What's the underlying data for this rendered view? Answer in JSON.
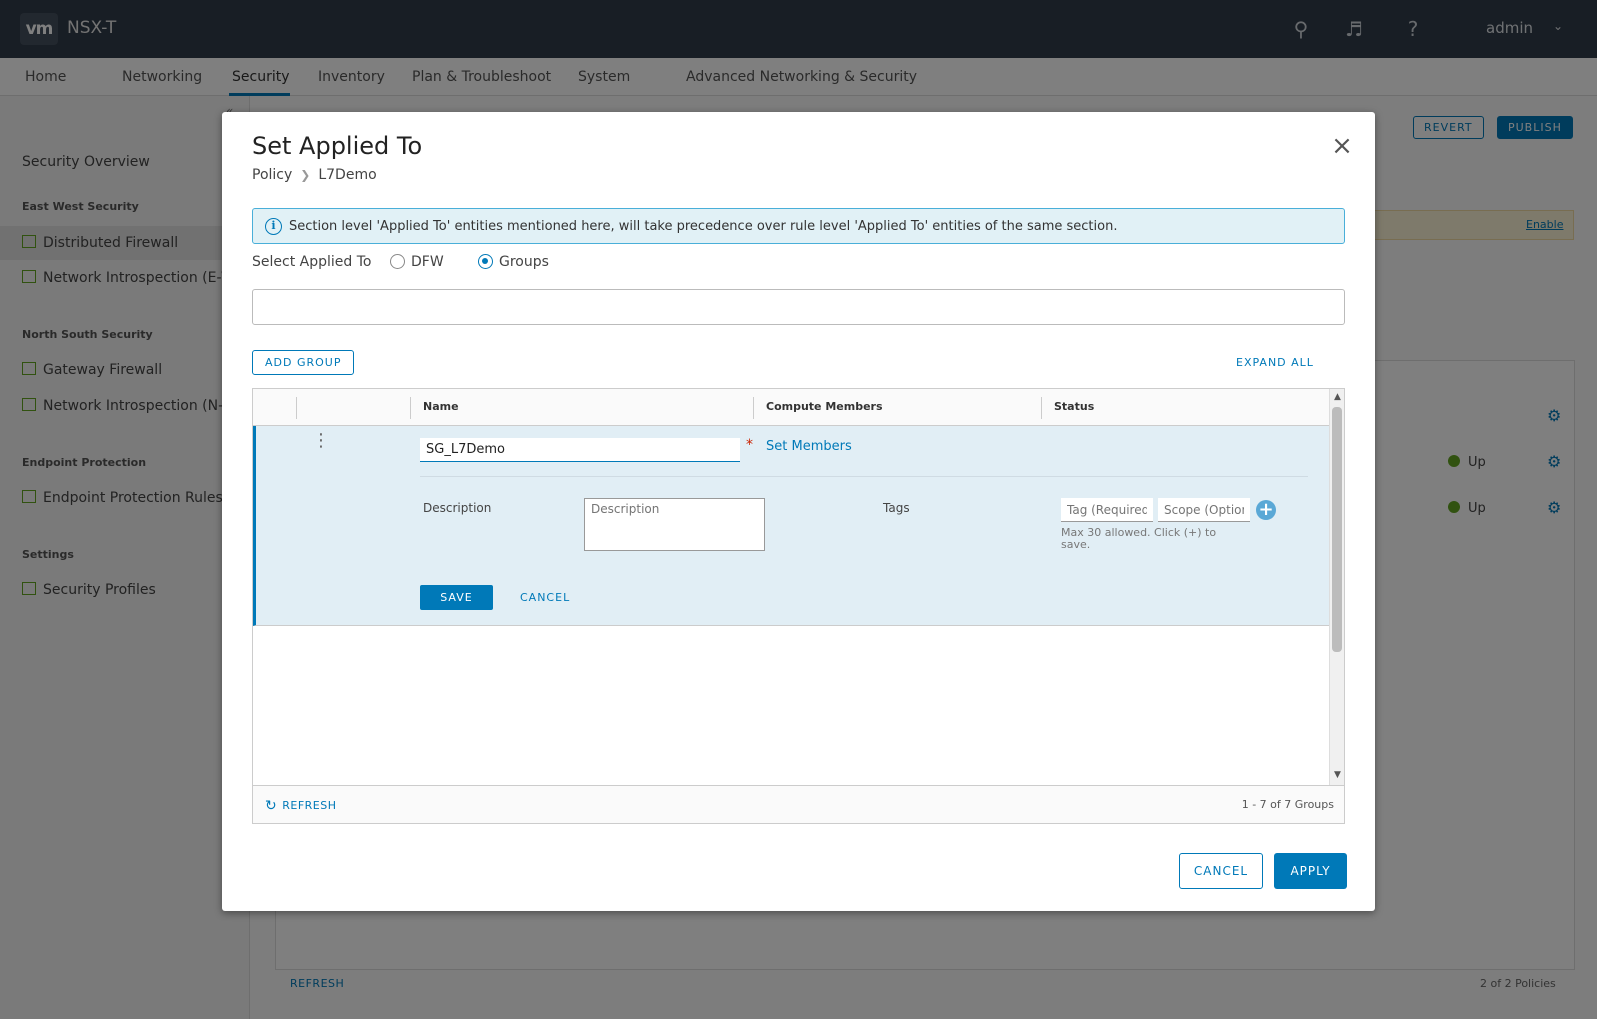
{
  "app": {
    "logo_text": "vm",
    "product_name": "NSX-T",
    "user": "admin"
  },
  "nav": {
    "items": [
      "Home",
      "Networking",
      "Security",
      "Inventory",
      "Plan & Troubleshoot",
      "System",
      "Advanced Networking & Security"
    ],
    "active": "Security"
  },
  "sidebar": {
    "overview": "Security Overview",
    "sections": [
      {
        "title": "East West Security",
        "items": [
          "Distributed Firewall",
          "Network Introspection (E-W)"
        ]
      },
      {
        "title": "North South Security",
        "items": [
          "Gateway Firewall",
          "Network Introspection (N-S)"
        ]
      },
      {
        "title": "Endpoint Protection",
        "items": [
          "Endpoint Protection Rules"
        ]
      },
      {
        "title": "Settings",
        "items": [
          "Security Profiles"
        ]
      }
    ],
    "selected": "Distributed Firewall"
  },
  "background": {
    "revert_label": "REVERT",
    "publish_label": "PUBLISH",
    "enable_label": "Enable",
    "rows": [
      {
        "status": "Up"
      },
      {
        "status": "Up"
      }
    ],
    "refresh_label": "REFRESH",
    "pager": "2 of 2 Policies"
  },
  "modal": {
    "title": "Set Applied To",
    "breadcrumb": [
      "Policy",
      "L7Demo"
    ],
    "info_text": "Section level 'Applied To' entities mentioned here, will take precedence over rule level 'Applied To' entities of the same section.",
    "select_label": "Select Applied To",
    "radio_dfw": "DFW",
    "radio_groups": "Groups",
    "selected_radio": "Groups",
    "search_value": "",
    "add_group_label": "ADD GROUP",
    "expand_all_label": "EXPAND ALL",
    "columns": [
      "Name",
      "Compute Members",
      "Status"
    ],
    "edit_row": {
      "name_value": "SG_L7Demo",
      "required_marker": "*",
      "set_members_label": "Set Members",
      "description_label": "Description",
      "description_placeholder": "Description",
      "tags_label": "Tags",
      "tag_placeholder": "Tag (Required)",
      "scope_placeholder": "Scope (Optional)",
      "tags_helper": "Max 30 allowed. Click (+) to save.",
      "save_label": "SAVE",
      "cancel_label": "CANCEL"
    },
    "refresh_label": "REFRESH",
    "pager": "1 - 7 of 7 Groups",
    "cancel_label": "CANCEL",
    "apply_label": "APPLY"
  }
}
